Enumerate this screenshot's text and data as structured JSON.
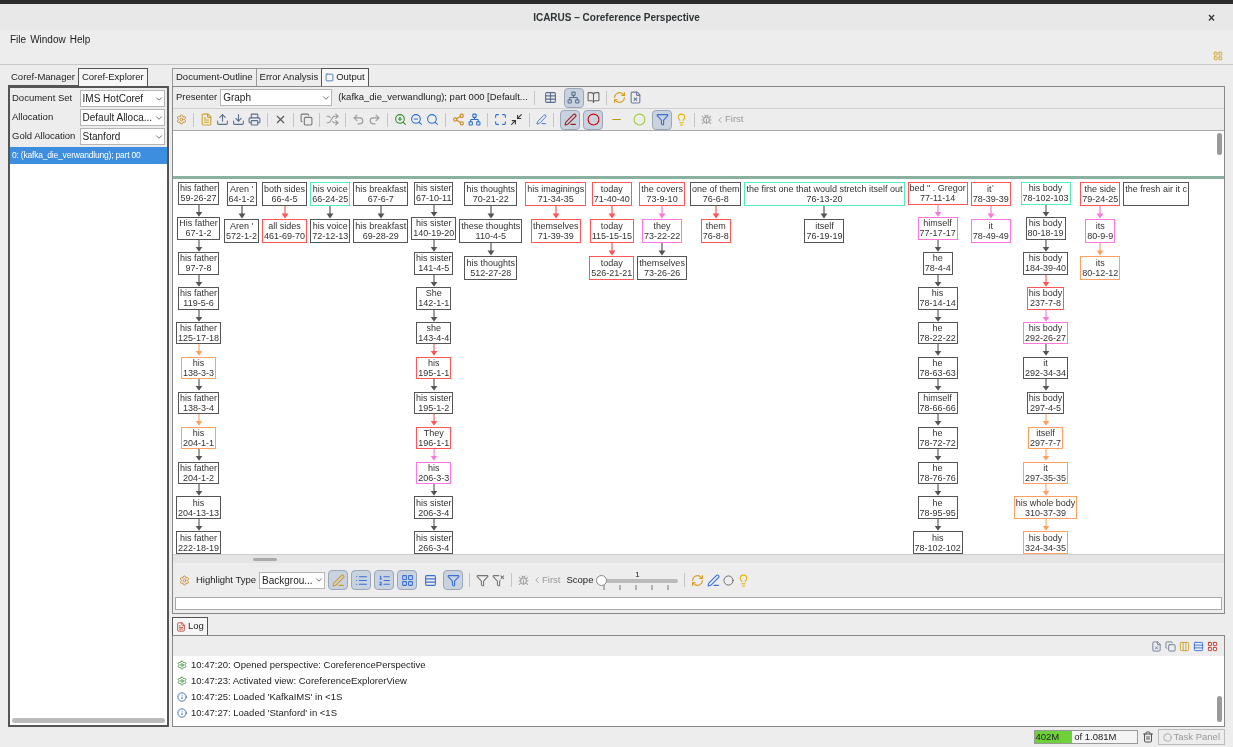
{
  "window": {
    "title": "ICARUS – Coreference Perspective",
    "close": "×"
  },
  "menu": [
    "File",
    "Window",
    "Help"
  ],
  "left_panel": {
    "tabs": [
      {
        "label": "Coref-Manager",
        "selected": false
      },
      {
        "label": "Coref-Explorer",
        "selected": true
      }
    ],
    "fields": [
      {
        "label": "Document Set",
        "value": "IMS HotCoref"
      },
      {
        "label": "Allocation",
        "value": "Default Alloca..."
      },
      {
        "label": "Gold Allocation",
        "value": "Stanford"
      }
    ],
    "documents": [
      {
        "text": "0: (kafka_die_verwandlung); part 00",
        "selected": true
      }
    ]
  },
  "editor": {
    "tabs": [
      {
        "label": "Document-Outline",
        "selected": false
      },
      {
        "label": "Error Analysis",
        "selected": false
      },
      {
        "label": "Output",
        "selected": true
      }
    ],
    "presenter_label": "Presenter",
    "presenter": "Graph",
    "document_title": "(kafka_die_verwandlung); part 000 [Default...",
    "presenter_toggles": [
      {
        "on": false
      },
      {
        "on": true
      }
    ],
    "graph_toggles": [
      {
        "on": true
      },
      {
        "on": true
      },
      {
        "on": false
      },
      {
        "on": false
      },
      {
        "on": true
      }
    ],
    "nav_label": "First"
  },
  "graph": {
    "columns": [
      {
        "nodes": [
          {
            "text": "his father",
            "ref": "59-26-27",
            "color": "#555555"
          },
          {
            "text": "His father",
            "ref": "67-1-2",
            "color": "#555555"
          },
          {
            "text": "his father",
            "ref": "97-7-8",
            "color": "#555555"
          },
          {
            "text": "his father",
            "ref": "119-5-6",
            "color": "#555555"
          },
          {
            "text": "his father",
            "ref": "125-17-18",
            "color": "#555555"
          },
          {
            "text": "his",
            "ref": "138-3-3",
            "color": "#ffa060"
          },
          {
            "text": "his father",
            "ref": "138-3-4",
            "color": "#555555"
          },
          {
            "text": "his",
            "ref": "204-1-1",
            "color": "#ffa060"
          },
          {
            "text": "his father",
            "ref": "204-1-2",
            "color": "#555555"
          },
          {
            "text": "his",
            "ref": "204-13-13",
            "color": "#555555"
          },
          {
            "text": "his father",
            "ref": "222-18-19",
            "color": "#555555"
          }
        ]
      },
      {
        "nodes": [
          {
            "text": "Aren '",
            "ref": "64-1-2",
            "color": "#555555"
          },
          {
            "text": "Aren '",
            "ref": "572-1-2",
            "color": "#555555"
          }
        ]
      },
      {
        "nodes": [
          {
            "text": "both sides",
            "ref": "66-4-5",
            "color": "#555555"
          },
          {
            "text": "all sides",
            "ref": "461-69-70",
            "color": "#ff5555"
          }
        ]
      },
      {
        "nodes": [
          {
            "text": "his voice",
            "ref": "66-24-25",
            "color": "#55eebb"
          },
          {
            "text": "his voice",
            "ref": "72-12-13",
            "color": "#555555"
          }
        ]
      },
      {
        "nodes": [
          {
            "text": "his breakfast",
            "ref": "67-6-7",
            "color": "#555555"
          },
          {
            "text": "his breakfast",
            "ref": "69-28-29",
            "color": "#555555"
          }
        ]
      },
      {
        "nodes": [
          {
            "text": "his sister",
            "ref": "67-10-11",
            "color": "#555555"
          },
          {
            "text": "his sister",
            "ref": "140-19-20",
            "color": "#555555"
          },
          {
            "text": "his sister",
            "ref": "141-4-5",
            "color": "#555555"
          },
          {
            "text": "She",
            "ref": "142-1-1",
            "color": "#555555"
          },
          {
            "text": "she",
            "ref": "143-4-4",
            "color": "#555555"
          },
          {
            "text": "his",
            "ref": "195-1-1",
            "color": "#ff5555"
          },
          {
            "text": "his sister",
            "ref": "195-1-2",
            "color": "#555555"
          },
          {
            "text": "They",
            "ref": "196-1-1",
            "color": "#ff5555"
          },
          {
            "text": "his",
            "ref": "206-3-3",
            "color": "#ff77dd"
          },
          {
            "text": "his sister",
            "ref": "206-3-4",
            "color": "#555555"
          },
          {
            "text": "his sister",
            "ref": "266-3-4",
            "color": "#555555"
          }
        ]
      },
      {
        "nodes": [
          {
            "text": "his thoughts",
            "ref": "70-21-22",
            "color": "#555555"
          },
          {
            "text": "these thoughts",
            "ref": "110-4-5",
            "color": "#555555"
          },
          {
            "text": "his thoughts",
            "ref": "512-27-28",
            "color": "#555555"
          }
        ]
      },
      {
        "nodes": [
          {
            "text": "his imaginings",
            "ref": "71-34-35",
            "color": "#ff5555"
          },
          {
            "text": "themselves",
            "ref": "71-39-39",
            "color": "#ff5555"
          }
        ]
      },
      {
        "nodes": [
          {
            "text": "today",
            "ref": "71-40-40",
            "color": "#ff5555"
          },
          {
            "text": "today",
            "ref": "115-15-15",
            "color": "#ff5555"
          },
          {
            "text": "today",
            "ref": "526-21-21",
            "color": "#ff5555"
          }
        ]
      },
      {
        "nodes": [
          {
            "text": "the covers",
            "ref": "73-9-10",
            "color": "#ff5555"
          },
          {
            "text": "they",
            "ref": "73-22-22",
            "color": "#ff77dd"
          },
          {
            "text": "themselves",
            "ref": "73-26-26",
            "color": "#555555"
          }
        ]
      },
      {
        "nodes": [
          {
            "text": "one of them",
            "ref": "76-6-8",
            "color": "#555555"
          },
          {
            "text": "them",
            "ref": "76-8-8",
            "color": "#ff5555"
          }
        ]
      },
      {
        "nodes": [
          {
            "text": "the first one that would stretch itself out",
            "ref": "76-13-20",
            "color": "#55eebb"
          },
          {
            "text": "itself",
            "ref": "76-19-19",
            "color": "#555555"
          }
        ]
      },
      {
        "nodes": [
          {
            "text": "bed \" . Gregor",
            "ref": "77-11-14",
            "color": "#ff5555"
          },
          {
            "text": "himself",
            "ref": "77-17-17",
            "color": "#ff77dd"
          },
          {
            "text": "he",
            "ref": "78-4-4",
            "color": "#555555"
          },
          {
            "text": "his",
            "ref": "78-14-14",
            "color": "#555555"
          },
          {
            "text": "he",
            "ref": "78-22-22",
            "color": "#555555"
          },
          {
            "text": "he",
            "ref": "78-63-63",
            "color": "#555555"
          },
          {
            "text": "himself",
            "ref": "78-66-66",
            "color": "#555555"
          },
          {
            "text": "he",
            "ref": "78-72-72",
            "color": "#555555"
          },
          {
            "text": "he",
            "ref": "78-76-76",
            "color": "#555555"
          },
          {
            "text": "he",
            "ref": "78-95-95",
            "color": "#555555"
          },
          {
            "text": "his",
            "ref": "78-102-102",
            "color": "#555555"
          }
        ]
      },
      {
        "nodes": [
          {
            "text": "it`",
            "ref": "78-39-39",
            "color": "#ff5555"
          },
          {
            "text": "it",
            "ref": "78-49-49",
            "color": "#ff77dd"
          }
        ]
      },
      {
        "nodes": [
          {
            "text": "his body",
            "ref": "78-102-103",
            "color": "#55eebb"
          },
          {
            "text": "his body",
            "ref": "80-18-19",
            "color": "#555555"
          },
          {
            "text": "his body",
            "ref": "184-39-40",
            "color": "#555555"
          },
          {
            "text": "his body",
            "ref": "237-7-8",
            "color": "#ff5555"
          },
          {
            "text": "his body",
            "ref": "292-26-27",
            "color": "#ff77dd"
          },
          {
            "text": "it",
            "ref": "292-34-34",
            "color": "#555555"
          },
          {
            "text": "his body",
            "ref": "297-4-5",
            "color": "#555555"
          },
          {
            "text": "itself",
            "ref": "297-7-7",
            "color": "#ffa060"
          },
          {
            "text": "it",
            "ref": "297-35-35",
            "color": "#ffa060"
          },
          {
            "text": "his whole body",
            "ref": "310-37-39",
            "color": "#ffa060"
          },
          {
            "text": "his body",
            "ref": "324-34-35",
            "color": "#ffa060"
          }
        ]
      },
      {
        "nodes": [
          {
            "text": "the side",
            "ref": "79-24-25",
            "color": "#ff5555"
          },
          {
            "text": "its",
            "ref": "80-9-9",
            "color": "#ff77dd"
          },
          {
            "text": "its",
            "ref": "80-12-12",
            "color": "#ffa060"
          }
        ]
      },
      {
        "nodes": [
          {
            "text": "the fresh air it c",
            "color": "#555555"
          }
        ]
      }
    ]
  },
  "highlight_bar": {
    "label": "Highlight Type",
    "value": "Backgrou...",
    "toggles": [
      {
        "on": true
      },
      {
        "on": true
      },
      {
        "on": true
      },
      {
        "on": true
      },
      {
        "on": false
      },
      {
        "on": true
      }
    ],
    "nav_label": "First",
    "scope_label": "Scope",
    "scope_value": "1",
    "scope": {
      "level": 0
    }
  },
  "log": {
    "tab": "Log",
    "entries": [
      {
        "kind": "event",
        "text": "10:47:20: Opened perspective: CoreferencePerspective"
      },
      {
        "kind": "event",
        "text": "10:47:23: Activated view: CoreferenceExplorerView"
      },
      {
        "kind": "info",
        "text": "10:47:25: Loaded 'KafkaIMS' in <1S"
      },
      {
        "kind": "info",
        "text": "10:47:27: Loaded 'Stanford' in <1S"
      }
    ]
  },
  "status": {
    "memory_used": "402M",
    "memory_total": "of 1.081M",
    "memory": {
      "level": 0.37
    },
    "task_panel": "Task Panel"
  }
}
